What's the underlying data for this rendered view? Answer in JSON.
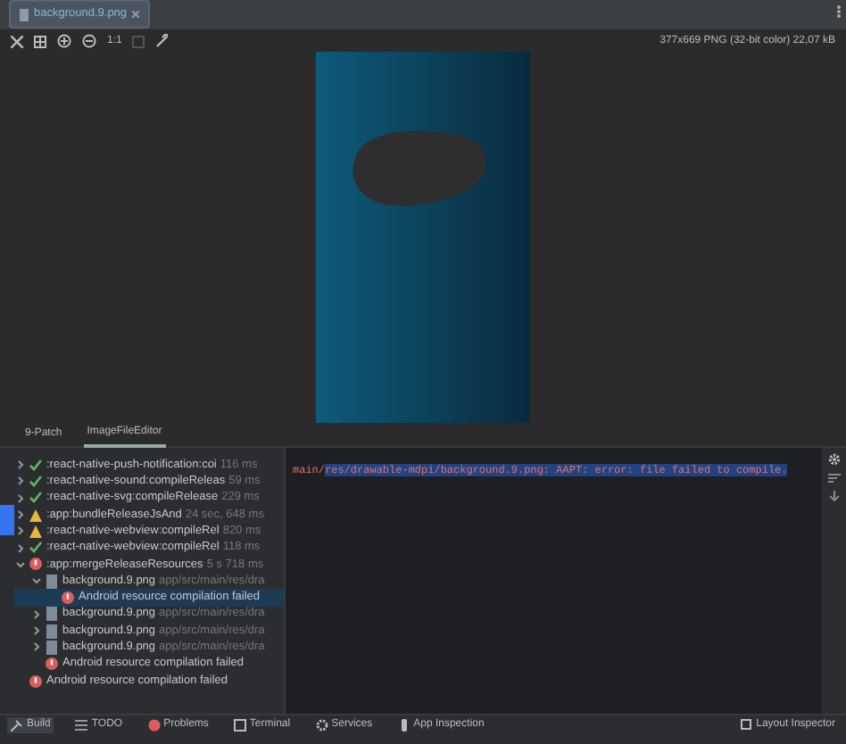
{
  "file_tab": {
    "title": "background.9.png"
  },
  "toolbar": {
    "zoom_label": "1:1",
    "image_info": "377x669 PNG (32-bit color) 22,07 kB"
  },
  "editor_tabs": [
    {
      "label": "9-Patch",
      "selected": false
    },
    {
      "label": "ImageFileEditor",
      "selected": true
    }
  ],
  "build_tree": [
    {
      "kind": "ok",
      "name": ":react-native-push-notification:coi",
      "detail": "116 ms",
      "expanded": false,
      "selected": false
    },
    {
      "kind": "ok",
      "name": ":react-native-sound:compileReleas",
      "detail": "59 ms",
      "expanded": false,
      "selected": false
    },
    {
      "kind": "ok",
      "name": ":react-native-svg:compileRelease",
      "detail": "229 ms",
      "expanded": false,
      "selected": false
    },
    {
      "kind": "warning",
      "name": ":app:bundleReleaseJsAnd",
      "detail": "24 sec, 648 ms",
      "expanded": false,
      "selected": false
    },
    {
      "kind": "warning",
      "name": ":react-native-webview:compileRel",
      "detail": "820 ms",
      "expanded": false,
      "selected": false
    },
    {
      "kind": "ok",
      "name": ":react-native-webview:compileRel",
      "detail": "118 ms",
      "expanded": false,
      "selected": false
    },
    {
      "kind": "error",
      "name": ":app:mergeReleaseResources",
      "detail": "5 s 718 ms",
      "expanded": true,
      "selected": false,
      "children": [
        {
          "kind": "file",
          "name": "background.9.png",
          "detail": "app/src/main/res/dra",
          "expanded": true,
          "selected": false,
          "children": [
            {
              "kind": "error",
              "name": "Android resource compilation failed",
              "selected": true
            }
          ]
        },
        {
          "kind": "file",
          "name": "background.9.png",
          "detail": "app/src/main/res/dra",
          "expanded": false,
          "selected": false
        },
        {
          "kind": "file",
          "name": "background.9.png",
          "detail": "app/src/main/res/dra",
          "expanded": false,
          "selected": false
        },
        {
          "kind": "file",
          "name": "background.9.png",
          "detail": "app/src/main/res/dra",
          "expanded": false,
          "selected": false
        },
        {
          "kind": "error",
          "name": "Android resource compilation failed",
          "selected": false
        }
      ]
    },
    {
      "kind": "error",
      "name": "Android resource compilation failed",
      "selected": false
    }
  ],
  "console": {
    "prefix": "main/",
    "message": "res/drawable-mdpi/background.9.png: AAPT: error: file failed to compile."
  },
  "tool_windows": [
    {
      "label": "Build",
      "selected": true
    },
    {
      "label": "TODO",
      "selected": false
    },
    {
      "label": "Problems",
      "selected": false
    },
    {
      "label": "Terminal",
      "selected": false
    },
    {
      "label": "Services",
      "selected": false
    },
    {
      "label": "App Inspection",
      "selected": false
    }
  ],
  "layout_inspector": "Layout Inspector"
}
